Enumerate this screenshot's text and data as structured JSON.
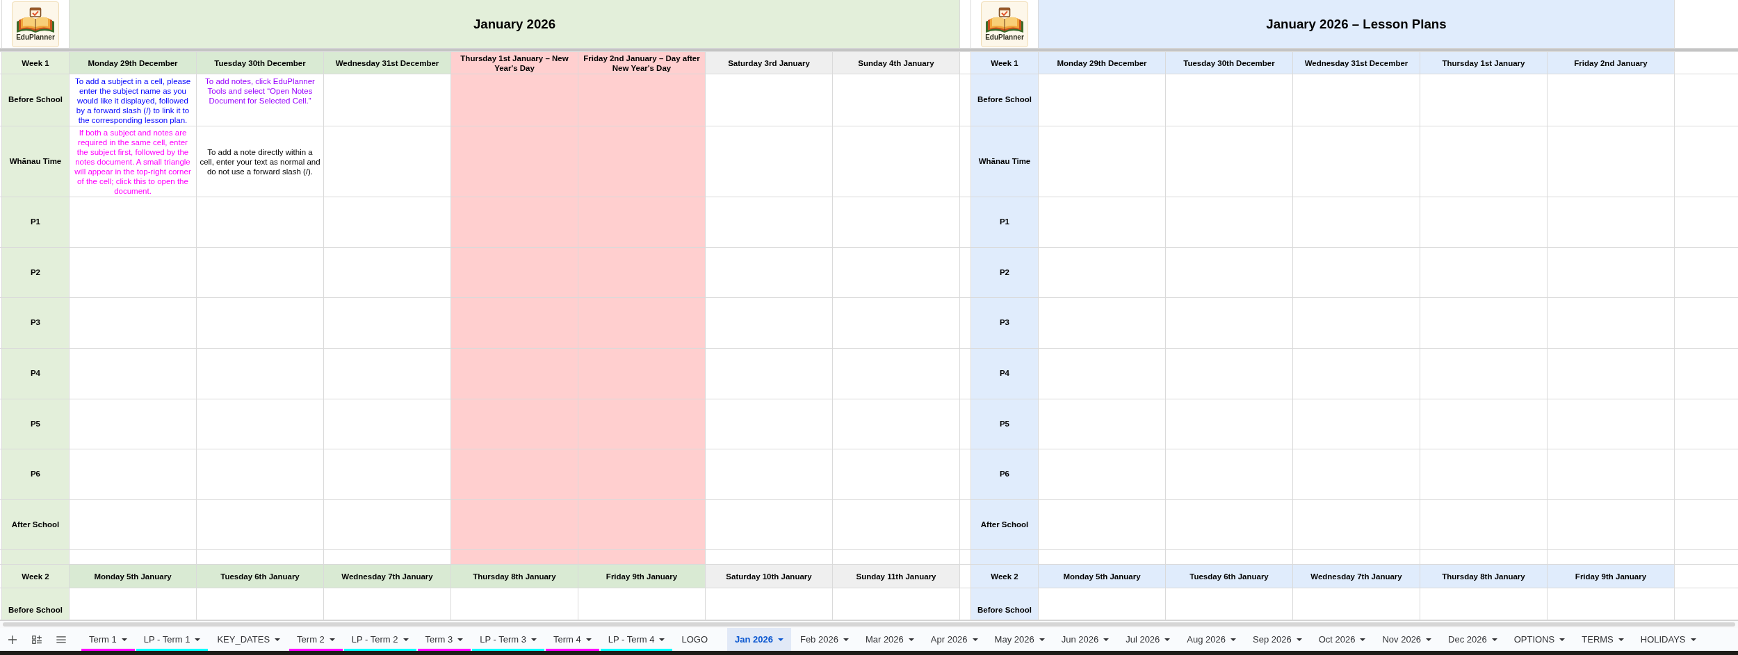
{
  "calendar": {
    "logo": {
      "text": "EduPlanner"
    },
    "title": "January 2026",
    "weeks": [
      {
        "label": "Week 1",
        "days": [
          {
            "label": "Monday 29th December",
            "kind": "weekday"
          },
          {
            "label": "Tuesday 30th December",
            "kind": "weekday"
          },
          {
            "label": "Wednesday 31st December",
            "kind": "weekday"
          },
          {
            "label": "Thursday 1st January – New Year's Day",
            "kind": "holiday"
          },
          {
            "label": "Friday 2nd January – Day after New Year's Day",
            "kind": "holiday"
          },
          {
            "label": "Saturday 3rd January",
            "kind": "weekend"
          },
          {
            "label": "Sunday 4th January",
            "kind": "weekend"
          }
        ],
        "rows": [
          {
            "label": "Before School",
            "cells": [
              {
                "text": "To add a subject in a cell, please enter the subject name as you would like it displayed, followed by a forward slash (/) to link it to the corresponding lesson plan.",
                "color": "#0000ff"
              },
              {
                "text": "To add notes, click EduPlanner Tools and select “Open Notes Document for Selected Cell.”",
                "color": "#9900ff"
              }
            ]
          },
          {
            "label": "Whānau Time",
            "cells": [
              {
                "text": "If both a subject and notes are required in the same cell, enter the subject first, followed by the notes document. A small triangle will appear in the top-right corner of the cell; click this to open the document.",
                "color": "#ff00ff"
              },
              {
                "text": "To add a note directly within a cell, enter your text as normal and do not use a forward slash (/).",
                "color": "#000000"
              }
            ]
          },
          {
            "label": "P1"
          },
          {
            "label": "P2"
          },
          {
            "label": "P3"
          },
          {
            "label": "P4"
          },
          {
            "label": "P5"
          },
          {
            "label": "P6"
          },
          {
            "label": "After School"
          }
        ]
      },
      {
        "label": "Week 2",
        "days": [
          {
            "label": "Monday 5th January",
            "kind": "weekday"
          },
          {
            "label": "Tuesday 6th January",
            "kind": "weekday"
          },
          {
            "label": "Wednesday 7th January",
            "kind": "weekday"
          },
          {
            "label": "Thursday 8th January",
            "kind": "weekday"
          },
          {
            "label": "Friday 9th January",
            "kind": "weekday"
          },
          {
            "label": "Saturday 10th January",
            "kind": "weekend"
          },
          {
            "label": "Sunday 11th January",
            "kind": "weekend"
          }
        ],
        "rows": [
          {
            "label": "Before School"
          }
        ]
      }
    ]
  },
  "lesson_plans": {
    "logo": {
      "text": "EduPlanner"
    },
    "title": "January 2026 – Lesson Plans",
    "weeks": [
      {
        "label": "Week 1",
        "days": [
          "Monday 29th December",
          "Tuesday 30th December",
          "Wednesday 31st December",
          "Thursday 1st January",
          "Friday 2nd January"
        ],
        "rows": [
          "Before School",
          "Whānau Time",
          "P1",
          "P2",
          "P3",
          "P4",
          "P5",
          "P6",
          "After School"
        ]
      },
      {
        "label": "Week 2",
        "days": [
          "Monday 5th January",
          "Tuesday 6th January",
          "Wednesday 7th January",
          "Thursday 8th January",
          "Friday 9th January"
        ],
        "rows": [
          "Before School"
        ]
      }
    ]
  },
  "sheet_tabs": [
    {
      "label": "Term 1",
      "selected": false,
      "dropdown": true,
      "color": "#ff00ff"
    },
    {
      "label": "LP - Term 1",
      "selected": false,
      "dropdown": true,
      "color": "#00ffff"
    },
    {
      "label": "KEY_DATES",
      "selected": false,
      "dropdown": true
    },
    {
      "label": "Term 2",
      "selected": false,
      "dropdown": true,
      "color": "#ff00ff"
    },
    {
      "label": "LP - Term 2",
      "selected": false,
      "dropdown": true,
      "color": "#00ffff"
    },
    {
      "label": "Term 3",
      "selected": false,
      "dropdown": true,
      "color": "#ff00ff"
    },
    {
      "label": "LP - Term 3",
      "selected": false,
      "dropdown": true,
      "color": "#00ffff"
    },
    {
      "label": "Term 4",
      "selected": false,
      "dropdown": true,
      "color": "#ff00ff"
    },
    {
      "label": "LP - Term 4",
      "selected": false,
      "dropdown": true,
      "color": "#00ffff"
    },
    {
      "label": "LOGO",
      "selected": false,
      "dropdown": false
    },
    {
      "label": "Jan 2026",
      "selected": true,
      "dropdown": true
    },
    {
      "label": "Feb 2026",
      "selected": false,
      "dropdown": true
    },
    {
      "label": "Mar 2026",
      "selected": false,
      "dropdown": true
    },
    {
      "label": "Apr 2026",
      "selected": false,
      "dropdown": true
    },
    {
      "label": "May 2026",
      "selected": false,
      "dropdown": true
    },
    {
      "label": "Jun 2026",
      "selected": false,
      "dropdown": true
    },
    {
      "label": "Jul 2026",
      "selected": false,
      "dropdown": true
    },
    {
      "label": "Aug 2026",
      "selected": false,
      "dropdown": true
    },
    {
      "label": "Sep 2026",
      "selected": false,
      "dropdown": true
    },
    {
      "label": "Oct 2026",
      "selected": false,
      "dropdown": true
    },
    {
      "label": "Nov 2026",
      "selected": false,
      "dropdown": true
    },
    {
      "label": "Dec 2026",
      "selected": false,
      "dropdown": true
    },
    {
      "label": "OPTIONS",
      "selected": false,
      "dropdown": true
    },
    {
      "label": "TERMS",
      "selected": false,
      "dropdown": true
    },
    {
      "label": "HOLIDAYS",
      "selected": false,
      "dropdown": true
    }
  ]
}
